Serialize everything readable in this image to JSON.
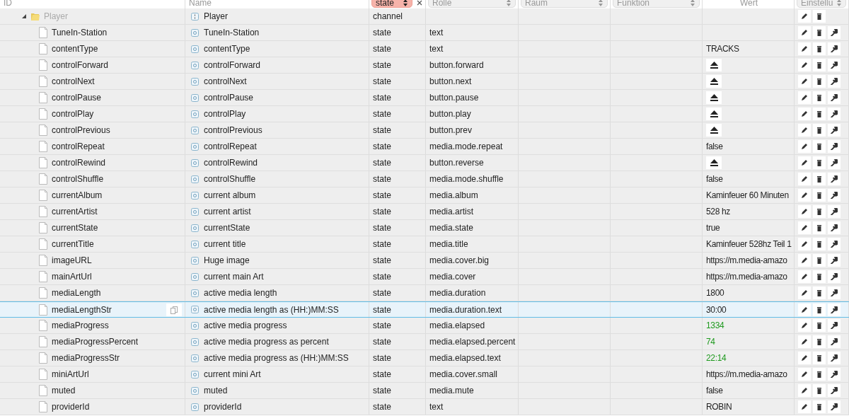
{
  "header": {
    "columns": [
      {
        "label": "ID",
        "kind": "label"
      },
      {
        "label": "Name",
        "kind": "label"
      },
      {
        "label": "state",
        "kind": "select",
        "active": true
      },
      {
        "label": "Rolle",
        "kind": "select",
        "active": false
      },
      {
        "label": "Raum",
        "kind": "select",
        "active": false
      },
      {
        "label": "Funktion",
        "kind": "select",
        "active": false
      },
      {
        "label": "Wert",
        "kind": "centered"
      },
      {
        "label": "Einstellu",
        "kind": "select",
        "active": false
      }
    ]
  },
  "tree": {
    "id": "Player",
    "name": "Player",
    "type": "channel",
    "kind": "channel",
    "expanded": true,
    "selected": false,
    "children": [
      {
        "id": "TuneIn-Station",
        "name": "TuneIn-Station",
        "type": "state",
        "role": "text",
        "kind": "state",
        "selected": false
      },
      {
        "id": "contentType",
        "name": "contentType",
        "type": "state",
        "role": "text",
        "value": {
          "kind": "plain",
          "text": "TRACKS",
          "acknowledged": true
        },
        "kind": "state",
        "selected": false
      },
      {
        "id": "controlForward",
        "name": "controlForward",
        "type": "state",
        "role": "button.forward",
        "value": {
          "kind": "button"
        },
        "kind": "state",
        "selected": false
      },
      {
        "id": "controlNext",
        "name": "controlNext",
        "type": "state",
        "role": "button.next",
        "value": {
          "kind": "button"
        },
        "kind": "state",
        "selected": false
      },
      {
        "id": "controlPause",
        "name": "controlPause",
        "type": "state",
        "role": "button.pause",
        "value": {
          "kind": "button"
        },
        "kind": "state",
        "selected": false
      },
      {
        "id": "controlPlay",
        "name": "controlPlay",
        "type": "state",
        "role": "button.play",
        "value": {
          "kind": "button"
        },
        "kind": "state",
        "selected": false
      },
      {
        "id": "controlPrevious",
        "name": "controlPrevious",
        "type": "state",
        "role": "button.prev",
        "value": {
          "kind": "button"
        },
        "kind": "state",
        "selected": false
      },
      {
        "id": "controlRepeat",
        "name": "controlRepeat",
        "type": "state",
        "role": "media.mode.repeat",
        "value": {
          "kind": "plain",
          "text": "false",
          "acknowledged": true
        },
        "kind": "state",
        "selected": false
      },
      {
        "id": "controlRewind",
        "name": "controlRewind",
        "type": "state",
        "role": "button.reverse",
        "value": {
          "kind": "button"
        },
        "kind": "state",
        "selected": false
      },
      {
        "id": "controlShuffle",
        "name": "controlShuffle",
        "type": "state",
        "role": "media.mode.shuffle",
        "value": {
          "kind": "plain",
          "text": "false",
          "acknowledged": true
        },
        "kind": "state",
        "selected": false
      },
      {
        "id": "currentAlbum",
        "name": "current album",
        "type": "state",
        "role": "media.album",
        "value": {
          "kind": "plain",
          "text": "Kaminfeuer 60 Minuten",
          "acknowledged": true
        },
        "kind": "state",
        "selected": false
      },
      {
        "id": "currentArtist",
        "name": "current artist",
        "type": "state",
        "role": "media.artist",
        "value": {
          "kind": "plain",
          "text": "528 hz",
          "acknowledged": true
        },
        "kind": "state",
        "selected": false
      },
      {
        "id": "currentState",
        "name": "currentState",
        "type": "state",
        "role": "media.state",
        "value": {
          "kind": "plain",
          "text": "true",
          "acknowledged": true
        },
        "kind": "state",
        "selected": false
      },
      {
        "id": "currentTitle",
        "name": "current title",
        "type": "state",
        "role": "media.title",
        "value": {
          "kind": "plain",
          "text": "Kaminfeuer 528hz Teil 1",
          "acknowledged": true
        },
        "kind": "state",
        "selected": false
      },
      {
        "id": "imageURL",
        "name": "Huge image",
        "type": "state",
        "role": "media.cover.big",
        "value": {
          "kind": "plain",
          "text": "https://m.media-amazo",
          "acknowledged": true
        },
        "kind": "state",
        "selected": false
      },
      {
        "id": "mainArtUrl",
        "name": "current main Art",
        "type": "state",
        "role": "media.cover",
        "value": {
          "kind": "plain",
          "text": "https://m.media-amazo",
          "acknowledged": true
        },
        "kind": "state",
        "selected": false
      },
      {
        "id": "mediaLength",
        "name": "active media length",
        "type": "state",
        "role": "media.duration",
        "value": {
          "kind": "plain",
          "text": "1800",
          "acknowledged": true
        },
        "kind": "state",
        "selected": false
      },
      {
        "id": "mediaLengthStr",
        "name": "active media length as (HH:)MM:SS",
        "type": "state",
        "role": "media.duration.text",
        "value": {
          "kind": "plain",
          "text": "30:00",
          "acknowledged": true
        },
        "kind": "state",
        "selected": true
      },
      {
        "id": "mediaProgress",
        "name": "active media progress",
        "type": "state",
        "role": "media.elapsed",
        "value": {
          "kind": "plain",
          "text": "1334",
          "acknowledged": false
        },
        "kind": "state",
        "selected": false
      },
      {
        "id": "mediaProgressPercent",
        "name": "active media progress as percent",
        "type": "state",
        "role": "media.elapsed.percent",
        "value": {
          "kind": "plain",
          "text": "74",
          "acknowledged": false
        },
        "kind": "state",
        "selected": false
      },
      {
        "id": "mediaProgressStr",
        "name": "active media progress as (HH:)MM:SS",
        "type": "state",
        "role": "media.elapsed.text",
        "value": {
          "kind": "plain",
          "text": "22:14",
          "acknowledged": false
        },
        "kind": "state",
        "selected": false
      },
      {
        "id": "miniArtUrl",
        "name": "current mini Art",
        "type": "state",
        "role": "media.cover.small",
        "value": {
          "kind": "plain",
          "text": "https://m.media-amazo",
          "acknowledged": true
        },
        "kind": "state",
        "selected": false
      },
      {
        "id": "muted",
        "name": "muted",
        "type": "state",
        "role": "media.mute",
        "value": {
          "kind": "plain",
          "text": "false",
          "acknowledged": true
        },
        "kind": "state",
        "selected": false
      },
      {
        "id": "providerId",
        "name": "providerId",
        "type": "state",
        "role": "text",
        "value": {
          "kind": "plain",
          "text": "ROBIN",
          "acknowledged": true
        },
        "kind": "state",
        "selected": false
      }
    ]
  }
}
